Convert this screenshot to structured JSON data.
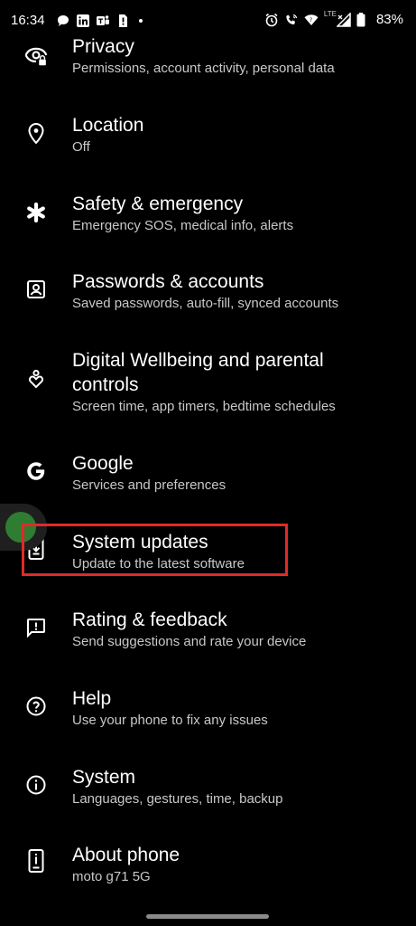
{
  "status_bar": {
    "time": "16:34",
    "network_label": "LTE",
    "battery": "83%"
  },
  "settings_items": [
    {
      "title": "Privacy",
      "subtitle": "Permissions, account activity, personal data",
      "icon": "eye-lock-icon"
    },
    {
      "title": "Location",
      "subtitle": "Off",
      "icon": "location-pin-icon"
    },
    {
      "title": "Safety & emergency",
      "subtitle": "Emergency SOS, medical info, alerts",
      "icon": "asterisk-icon"
    },
    {
      "title": "Passwords & accounts",
      "subtitle": "Saved passwords, auto-fill, synced accounts",
      "icon": "account-box-icon"
    },
    {
      "title": "Digital Wellbeing and parental controls",
      "title_line1": "Digital Wellbeing and parental",
      "title_line2": "controls",
      "subtitle": "Screen time, app timers, bedtime schedules",
      "icon": "wellbeing-icon"
    },
    {
      "title": "Google",
      "subtitle": "Services and preferences",
      "icon": "google-g-icon"
    },
    {
      "title": "System updates",
      "subtitle": "Update to the latest software",
      "icon": "phone-download-icon"
    },
    {
      "title": "Rating & feedback",
      "subtitle": "Send suggestions and rate your device",
      "icon": "feedback-icon"
    },
    {
      "title": "Help",
      "subtitle": "Use your phone to fix any issues",
      "icon": "help-icon"
    },
    {
      "title": "System",
      "subtitle": "Languages, gestures, time, backup",
      "icon": "info-icon"
    },
    {
      "title": "About phone",
      "subtitle": "moto g71 5G",
      "icon": "phone-icon"
    }
  ],
  "colors": {
    "background": "#000000",
    "highlight": "#e02a2a",
    "subtitle": "#c8c8c8"
  }
}
